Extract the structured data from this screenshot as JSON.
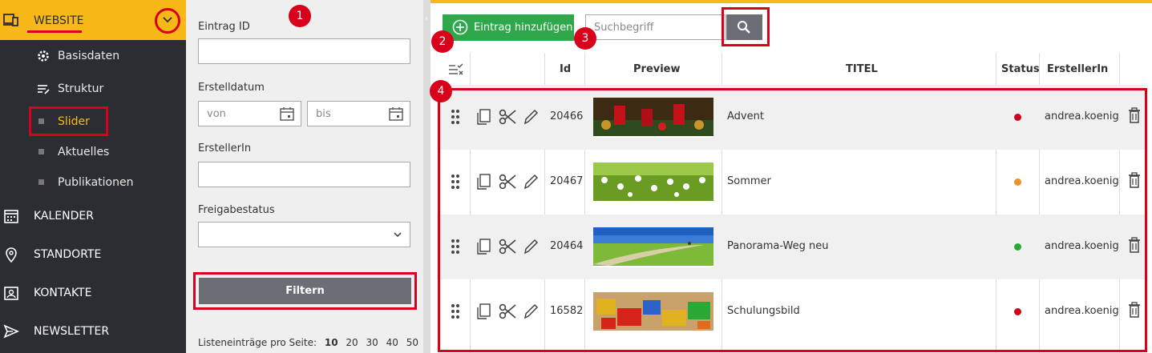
{
  "sidebar": {
    "section": "WEBSITE",
    "sub_items": [
      {
        "label": "Basisdaten",
        "icon": "gear-icon"
      },
      {
        "label": "Struktur",
        "icon": "structure-icon"
      },
      {
        "label": "Slider",
        "icon": "square-bullet",
        "active": true
      },
      {
        "label": "Aktuelles",
        "icon": "square-bullet"
      },
      {
        "label": "Publikationen",
        "icon": "square-bullet"
      }
    ],
    "main_items": [
      {
        "label": "KALENDER",
        "icon": "calendar-icon"
      },
      {
        "label": "STANDORTE",
        "icon": "location-pin-icon"
      },
      {
        "label": "KONTAKTE",
        "icon": "contact-card-icon"
      },
      {
        "label": "NEWSLETTER",
        "icon": "send-icon"
      }
    ]
  },
  "filter": {
    "entry_id_label": "Eintrag ID",
    "entry_id_value": "",
    "created_label": "Erstelldatum",
    "from_placeholder": "von",
    "to_placeholder": "bis",
    "creator_label": "ErstellerIn",
    "creator_value": "",
    "status_label": "Freigabestatus",
    "status_value": "",
    "filter_button": "Filtern",
    "per_page_label": "Listeneinträge pro Seite:",
    "per_page_options": [
      "10",
      "20",
      "30",
      "40",
      "50"
    ],
    "per_page_selected": "10"
  },
  "callouts": [
    "1",
    "2",
    "3",
    "4"
  ],
  "toolbar": {
    "add_button": "Eintrag hinzufügen",
    "search_placeholder": "Suchbegriff"
  },
  "table": {
    "columns": {
      "id": "Id",
      "preview": "Preview",
      "title": "TITEL",
      "status": "Status",
      "creator": "ErstellerIn"
    },
    "rows": [
      {
        "id": "20466",
        "title": "Advent",
        "status_color": "#d0021b",
        "creator": "andrea.koenig",
        "preview": "advent-candles"
      },
      {
        "id": "20467",
        "title": "Sommer",
        "status_color": "#e8932e",
        "creator": "andrea.koenig",
        "preview": "daisy-meadow"
      },
      {
        "id": "20464",
        "title": "Panorama-Weg neu",
        "status_color": "#2aa836",
        "creator": "andrea.koenig",
        "preview": "panorama-path"
      },
      {
        "id": "16582",
        "title": "Schulungsbild",
        "status_color": "#d0021b",
        "creator": "andrea.koenig",
        "preview": "toy-blocks"
      }
    ]
  },
  "colors": {
    "accent": "#f8b918",
    "sidebar": "#2b2d33",
    "highlight": "#d9001b",
    "add": "#2ea84a"
  }
}
